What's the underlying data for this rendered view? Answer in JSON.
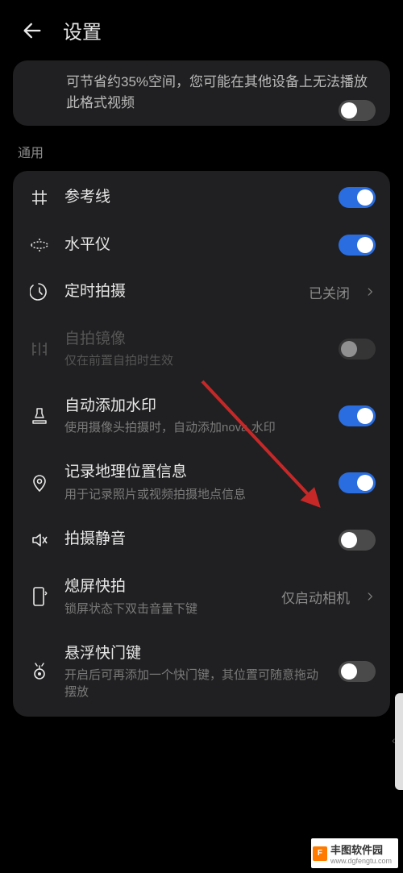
{
  "header": {
    "title": "设置"
  },
  "section1": {
    "truncated_text": "可节省约35%空间，您可能在其他设备上无法播放此格式视频"
  },
  "section_general_label": "通用",
  "general": {
    "grid": {
      "label": "参考线"
    },
    "level": {
      "label": "水平仪"
    },
    "timer": {
      "label": "定时拍摄",
      "value": "已关闭"
    },
    "selfie_mirror": {
      "label": "自拍镜像",
      "sub": "仅在前置自拍时生效"
    },
    "watermark": {
      "label": "自动添加水印",
      "sub": "使用摄像头拍摄时，自动添加nova 水印"
    },
    "location": {
      "label": "记录地理位置信息",
      "sub": "用于记录照片或视频拍摄地点信息"
    },
    "mute": {
      "label": "拍摄静音"
    },
    "lock_snap": {
      "label": "熄屏快拍",
      "sub": "锁屏状态下双击音量下键",
      "value": "仅启动相机"
    },
    "float_shutter": {
      "label": "悬浮快门键",
      "sub": "开启后可再添加一个快门键，其位置可随意拖动摆放"
    }
  },
  "watermark_brand": "丰图软件园",
  "watermark_url": "www.dgfengtu.com"
}
